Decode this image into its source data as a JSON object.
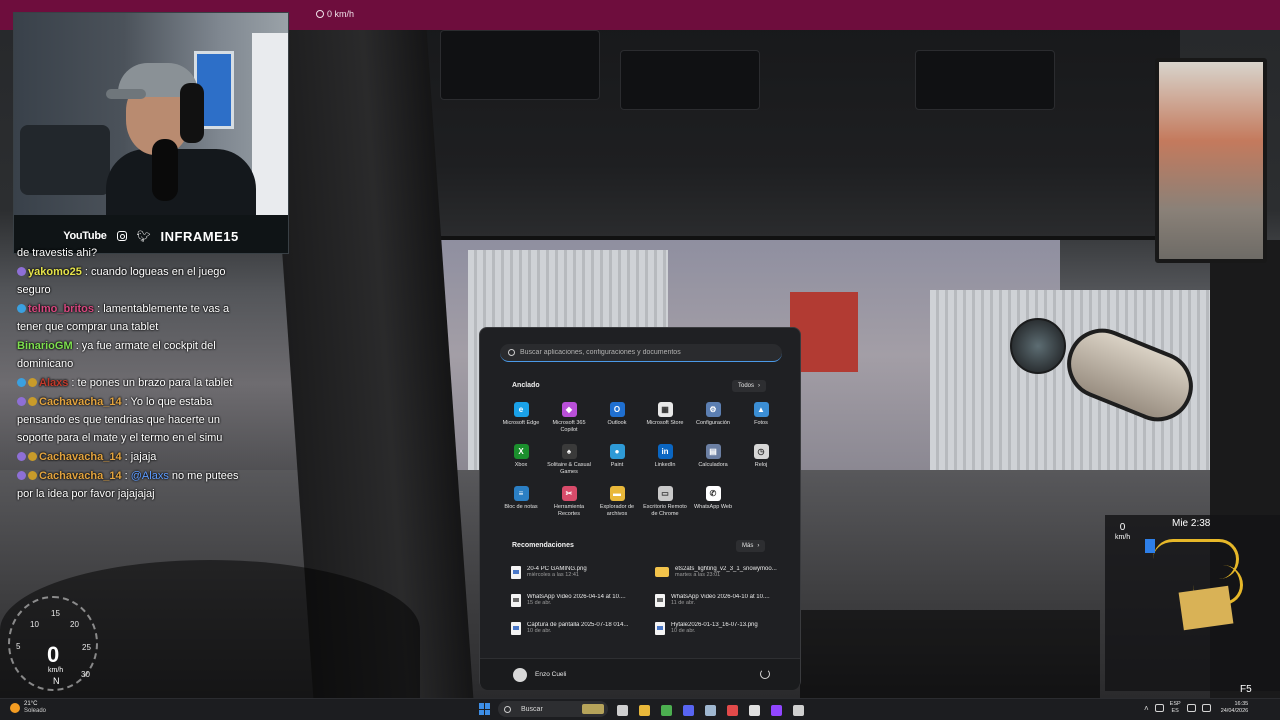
{
  "overlay": {
    "top_speed": "0 km/h",
    "social": {
      "platform": "YouTube",
      "handle": "INFRAME15"
    }
  },
  "chat": {
    "messages": [
      {
        "user": "",
        "text": "de travestis ahi?"
      },
      {
        "user": "yakomo25",
        "text": ": cuando logueas en el juego seguro"
      },
      {
        "user": "telmo_britos",
        "text": ": lamentablemente te vas a tener que comprar una tablet"
      },
      {
        "user": "BinarioGM",
        "text": ": ya fue armate el cockpit del dominicano"
      },
      {
        "user": "Alaxs",
        "text": ": te pones un brazo para la tablet"
      },
      {
        "user": "Cachavacha_14",
        "text": ": Yo lo que estaba pensando es que tendrias que hacerte un soporte para el mate y el termo en el simu"
      },
      {
        "user": "Cachavacha_14",
        "text": ": jajaja"
      },
      {
        "user": "Cachavacha_14",
        "text": ":",
        "mention": "@Alaxs",
        "rest": "no me putees por la idea por favor jajajajaj"
      }
    ]
  },
  "hud": {
    "speed": "0",
    "speed_unit": "km/h",
    "gear": "N",
    "ticks": [
      "10",
      "15",
      "20",
      "25",
      "30",
      "5"
    ],
    "map_speed": "0",
    "map_speed_unit": "km/h",
    "map_time": "Mie 2:38",
    "fkey": "F5"
  },
  "start_menu": {
    "search_placeholder": "Buscar aplicaciones, configuraciones y documentos",
    "pinned_title": "Anclado",
    "all_label": "Todos",
    "pinned": [
      {
        "label": "Microsoft Edge",
        "icon": "edge-icon",
        "color": "#1aa1e8",
        "glyph": "e"
      },
      {
        "label": "Microsoft 365 Copilot",
        "icon": "copilot-icon",
        "color": "#b94fd9",
        "glyph": "◆"
      },
      {
        "label": "Outlook",
        "icon": "outlook-icon",
        "color": "#1f6fd0",
        "glyph": "O"
      },
      {
        "label": "Microsoft Store",
        "icon": "store-icon",
        "color": "#e8e8e8",
        "glyph": "▦"
      },
      {
        "label": "Configuración",
        "icon": "settings-icon",
        "color": "#5c7fb2",
        "glyph": "⚙"
      },
      {
        "label": "Fotos",
        "icon": "photos-icon",
        "color": "#3b8ed4",
        "glyph": "▲"
      },
      {
        "label": "Xbox",
        "icon": "xbox-icon",
        "color": "#1b8f2d",
        "glyph": "X"
      },
      {
        "label": "Solitaire & Casual Games",
        "icon": "solitaire-icon",
        "color": "#3a3a3a",
        "glyph": "♠"
      },
      {
        "label": "Paint",
        "icon": "paint-icon",
        "color": "#2e9ad6",
        "glyph": "●"
      },
      {
        "label": "LinkedIn",
        "icon": "linkedin-icon",
        "color": "#0a66c2",
        "glyph": "in"
      },
      {
        "label": "Calculadora",
        "icon": "calculator-icon",
        "color": "#6b7fa3",
        "glyph": "▤"
      },
      {
        "label": "Reloj",
        "icon": "clock-icon",
        "color": "#d6d6d6",
        "glyph": "◷"
      },
      {
        "label": "Bloc de notas",
        "icon": "notepad-icon",
        "color": "#2b7fc4",
        "glyph": "≡"
      },
      {
        "label": "Herramienta Recortes",
        "icon": "snipping-icon",
        "color": "#d84b6a",
        "glyph": "✂"
      },
      {
        "label": "Explorador de archivos",
        "icon": "file-explorer-icon",
        "color": "#e9b83a",
        "glyph": "▬"
      },
      {
        "label": "Escritorio Remoto de Chrome",
        "icon": "remote-desktop-icon",
        "color": "#c9c9c9",
        "glyph": "▭"
      },
      {
        "label": "WhatsApp Web",
        "icon": "whatsapp-icon",
        "color": "#ffffff",
        "glyph": "✆"
      }
    ],
    "recs_title": "Recomendaciones",
    "more_label": "Más",
    "recommendations": [
      {
        "name": "20-4 PC GAMING.png",
        "sub": "miércoles a las 12:41",
        "kind": "image"
      },
      {
        "name": "ets2ats_lighting_v2_3_1_snowymoo...",
        "sub": "martes a las 23:01",
        "kind": "folder"
      },
      {
        "name": "WhatsApp Video 2026-04-14 at 10....",
        "sub": "15 de abr.",
        "kind": "media"
      },
      {
        "name": "WhatsApp Video 2026-04-10 at 10....",
        "sub": "11 de abr.",
        "kind": "media"
      },
      {
        "name": "Captura de pantalla 2025-07-18 014...",
        "sub": "10 de abr.",
        "kind": "image"
      },
      {
        "name": "Hytale2026-01-13_16-07-13.png",
        "sub": "10 de abr.",
        "kind": "image"
      }
    ],
    "user": "Enzo Cueli"
  },
  "taskbar": {
    "weather_temp": "21°C",
    "weather_desc": "Soleado",
    "search_label": "Buscar",
    "apps": [
      {
        "icon": "task-view-icon",
        "color": "#cfcfcf"
      },
      {
        "icon": "file-explorer-icon",
        "color": "#e9b83a"
      },
      {
        "icon": "chrome-icon",
        "color": "#4caf50"
      },
      {
        "icon": "discord-icon",
        "color": "#5865f2"
      },
      {
        "icon": "steam-icon",
        "color": "#9fb7d0"
      },
      {
        "icon": "capcut-icon",
        "color": "#e24a4a"
      },
      {
        "icon": "capture-icon",
        "color": "#e0e0e0"
      },
      {
        "icon": "twitch-icon",
        "color": "#9146ff"
      },
      {
        "icon": "ets2-icon",
        "color": "#cfcfcf"
      }
    ],
    "lang_top": "ESP",
    "lang_bottom": "ES",
    "time": "16:35",
    "date": "24/04/2026"
  }
}
